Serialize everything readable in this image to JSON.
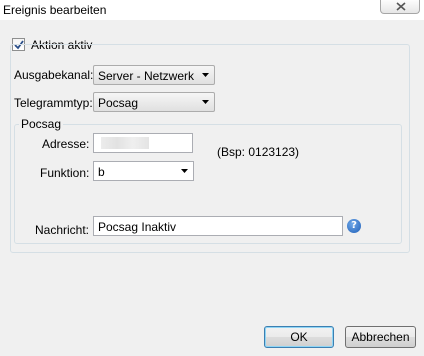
{
  "window": {
    "title": "Ereignis bearbeiten",
    "close_icon": "close-icon"
  },
  "aktion": {
    "label": "Aktion aktiv",
    "checked": true
  },
  "ausgabekanal": {
    "label": "Ausgabekanal:",
    "value": "Server - Netzwerk"
  },
  "telegrammtyp": {
    "label": "Telegrammtyp:",
    "value": "Pocsag"
  },
  "pocsag": {
    "legend": "Pocsag",
    "adresse_label": "Adresse:",
    "adresse_hint": "(Bsp: 0123123)",
    "funktion_label": "Funktion:",
    "funktion_value": "b",
    "nachricht_label": "Nachricht:",
    "nachricht_value": "Pocsag Inaktiv",
    "help_icon": "?"
  },
  "buttons": {
    "ok": "OK",
    "cancel": "Abbrechen"
  }
}
